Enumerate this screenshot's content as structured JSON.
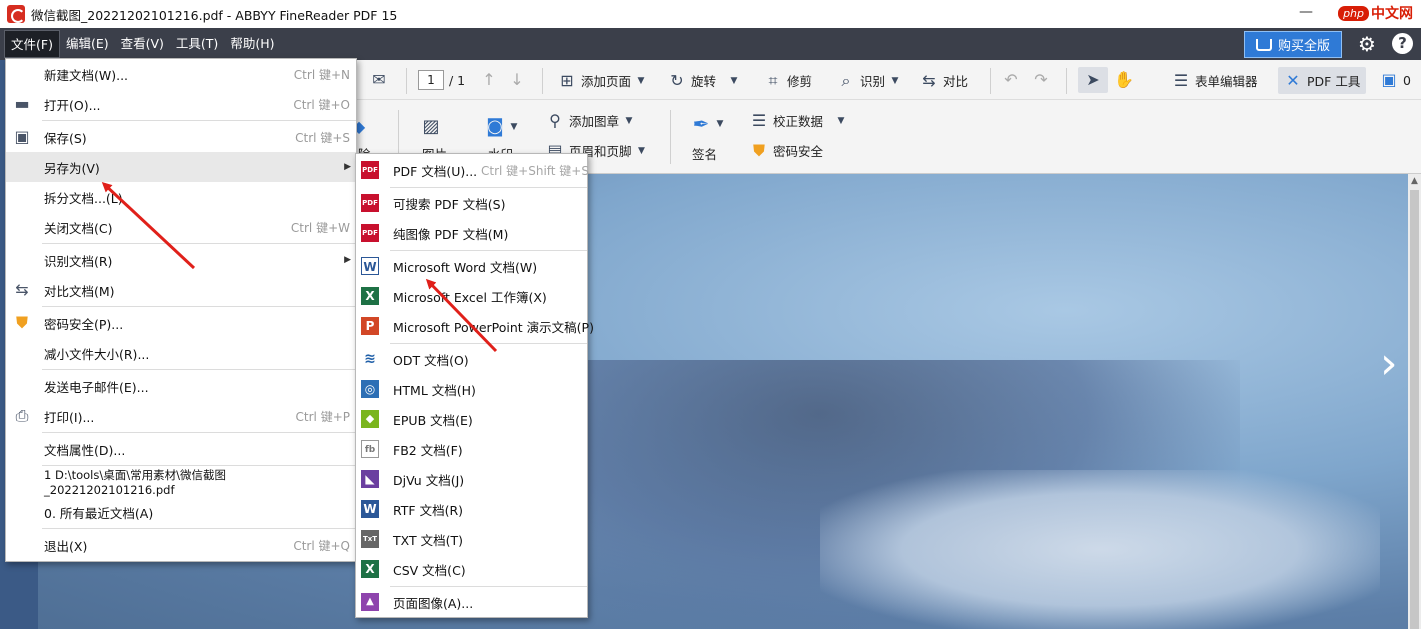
{
  "window": {
    "title": "微信截图_20221202101216.pdf - ABBYY FineReader PDF 15",
    "minimize": "—"
  },
  "watermark": {
    "badge": "php",
    "text": "中文网"
  },
  "menubar": {
    "items": [
      "文件(F)",
      "编辑(E)",
      "查看(V)",
      "工具(T)",
      "帮助(H)"
    ],
    "buy_label": "购买全版"
  },
  "toolbar1": {
    "page_current": "1",
    "page_total": "/ 1",
    "add_page": "添加页面",
    "rotate": "旋转",
    "crop": "修剪",
    "recognize": "识别",
    "compare": "对比",
    "form_editor": "表单编辑器",
    "pdf_tools": "PDF 工具",
    "comments_count": "0"
  },
  "toolbar2": {
    "delete_partial": "除",
    "image": "图片",
    "watermark": "水印",
    "add_stamp": "添加图章",
    "header_footer": "页眉和页脚",
    "sign": "签名",
    "redact": "校正数据",
    "password": "密码安全"
  },
  "file_menu": [
    {
      "label": "新建文档(W)...",
      "shortcut": "Ctrl 键+N",
      "icon": "none"
    },
    {
      "label": "打开(O)...",
      "shortcut": "Ctrl 键+O",
      "icon": "folder-icon"
    },
    {
      "label": "保存(S)",
      "shortcut": "Ctrl 键+S",
      "icon": "save-icon"
    },
    {
      "label": "另存为(V)",
      "shortcut": "",
      "icon": "none",
      "submenu": true
    },
    {
      "label": "拆分文档...(L)",
      "shortcut": "",
      "icon": "none"
    },
    {
      "label": "关闭文档(C)",
      "shortcut": "Ctrl 键+W",
      "icon": "none"
    },
    {
      "label": "识别文档(R)",
      "shortcut": "",
      "icon": "none",
      "submenu": true
    },
    {
      "label": "对比文档(M)",
      "shortcut": "",
      "icon": "compare-icon"
    },
    {
      "label": "密码安全(P)...",
      "shortcut": "",
      "icon": "shield-icon"
    },
    {
      "label": "减小文件大小(R)...",
      "shortcut": "",
      "icon": "none"
    },
    {
      "label": "发送电子邮件(E)...",
      "shortcut": "",
      "icon": "none"
    },
    {
      "label": "打印(I)...",
      "shortcut": "Ctrl 键+P",
      "icon": "printer-icon"
    },
    {
      "label": "文档属性(D)...",
      "shortcut": "",
      "icon": "none"
    },
    {
      "label": "1 D:\\tools\\桌面\\常用素材\\微信截图_20221202101216.pdf",
      "shortcut": "",
      "icon": "none"
    },
    {
      "label": "0. 所有最近文档(A)",
      "shortcut": "",
      "icon": "none"
    },
    {
      "label": "退出(X)",
      "shortcut": "Ctrl 键+Q",
      "icon": "none"
    }
  ],
  "save_as_menu": [
    {
      "label": "PDF 文档(U)...",
      "shortcut": "Ctrl 键+Shift 键+S",
      "badge": "PDF",
      "color": "#c8102e"
    },
    {
      "label": "可搜索 PDF 文档(S)",
      "shortcut": "",
      "badge": "PDF",
      "color": "#c8102e"
    },
    {
      "label": "纯图像 PDF 文档(M)",
      "shortcut": "",
      "badge": "PDF",
      "color": "#c8102e"
    },
    {
      "label": "Microsoft Word 文档(W)",
      "shortcut": "",
      "badge": "W",
      "color": "#2b5797"
    },
    {
      "label": "Microsoft Excel 工作簿(X)",
      "shortcut": "",
      "badge": "X",
      "color": "#1e7145"
    },
    {
      "label": "Microsoft PowerPoint 演示文稿(P)",
      "shortcut": "",
      "badge": "P",
      "color": "#d24726"
    },
    {
      "label": "ODT 文档(O)",
      "shortcut": "",
      "badge": "≋",
      "color": "#1f5fa8"
    },
    {
      "label": "HTML 文档(H)",
      "shortcut": "",
      "badge": "◎",
      "color": "#2d6fb5"
    },
    {
      "label": "EPUB 文档(E)",
      "shortcut": "",
      "badge": "◆",
      "color": "#7ab51d"
    },
    {
      "label": "FB2 文档(F)",
      "shortcut": "",
      "badge": "fb",
      "color": "#777777"
    },
    {
      "label": "DjVu 文档(J)",
      "shortcut": "",
      "badge": "◣",
      "color": "#6b3fa0"
    },
    {
      "label": "RTF 文档(R)",
      "shortcut": "",
      "badge": "W",
      "color": "#2b5797"
    },
    {
      "label": "TXT 文档(T)",
      "shortcut": "",
      "badge": "TxT",
      "color": "#666666"
    },
    {
      "label": "CSV 文档(C)",
      "shortcut": "",
      "badge": "X",
      "color": "#1e7145"
    },
    {
      "label": "页面图像(A)...",
      "shortcut": "",
      "badge": "▲",
      "color": "#8e44ad"
    }
  ],
  "colors": {
    "menubar": "#3b3f4a",
    "accent": "#2f7ad6",
    "annotation_arrow": "#e0201a"
  }
}
